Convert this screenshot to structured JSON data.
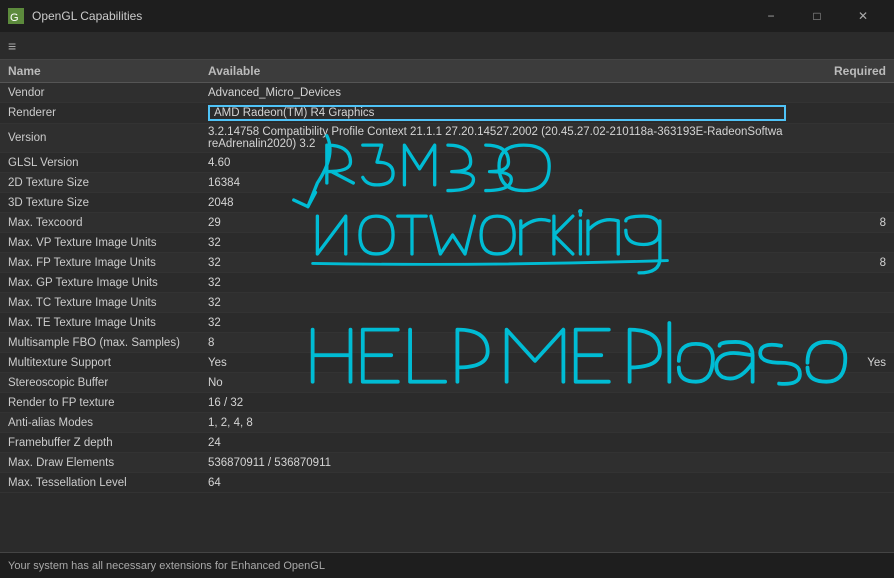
{
  "window": {
    "title": "OpenGL Capabilities",
    "icon": "⬜"
  },
  "toolbar": {
    "menu_icon": "≡"
  },
  "table": {
    "headers": {
      "name": "Name",
      "available": "Available",
      "required": "Required"
    },
    "rows": [
      {
        "name": "Vendor",
        "available": "Advanced_Micro_Devices",
        "required": "",
        "highlighted": false
      },
      {
        "name": "Renderer",
        "available": "AMD Radeon(TM) R4 Graphics",
        "required": "",
        "highlighted": true
      },
      {
        "name": "Version",
        "available": "3.2.14758 Compatibility Profile Context 21.1.1 27.20.14527.2002 (20.45.27.02-210118a-363193E-RadeonSoftwareAdrenalin2020)  3.2",
        "required": "",
        "highlighted": false
      },
      {
        "name": "GLSL Version",
        "available": "4.60",
        "required": "",
        "highlighted": false
      },
      {
        "name": "2D Texture Size",
        "available": "16384",
        "required": "",
        "highlighted": false
      },
      {
        "name": "3D Texture Size",
        "available": "2048",
        "required": "",
        "highlighted": false
      },
      {
        "name": "Max. Texcoord",
        "available": "29",
        "required": "8",
        "highlighted": false
      },
      {
        "name": "Max. VP Texture Image Units",
        "available": "32",
        "required": "",
        "highlighted": false
      },
      {
        "name": "Max. FP Texture Image Units",
        "available": "32",
        "required": "8",
        "highlighted": false
      },
      {
        "name": "Max. GP Texture Image Units",
        "available": "32",
        "required": "",
        "highlighted": false
      },
      {
        "name": "Max. TC Texture Image Units",
        "available": "32",
        "required": "",
        "highlighted": false
      },
      {
        "name": "Max. TE Texture Image Units",
        "available": "32",
        "required": "",
        "highlighted": false
      },
      {
        "name": "Multisample FBO (max. Samples)",
        "available": "8",
        "required": "",
        "highlighted": false
      },
      {
        "name": "Multitexture Support",
        "available": "Yes",
        "required": "Yes",
        "highlighted": false
      },
      {
        "name": "Stereoscopic Buffer",
        "available": "No",
        "required": "",
        "highlighted": false
      },
      {
        "name": "Render to FP texture",
        "available": "16 / 32",
        "required": "",
        "highlighted": false
      },
      {
        "name": "Anti-alias Modes",
        "available": "1, 2, 4, 8",
        "required": "",
        "highlighted": false
      },
      {
        "name": "Framebuffer Z depth",
        "available": "24",
        "required": "",
        "highlighted": false
      },
      {
        "name": "Max. Draw Elements",
        "available": "536870911 / 536870911",
        "required": "",
        "highlighted": false
      },
      {
        "name": "Max. Tessellation Level",
        "available": "64",
        "required": "",
        "highlighted": false
      }
    ]
  },
  "status_bar": {
    "text": "Your system has all necessary extensions for Enhanced OpenGL"
  },
  "title_bar_controls": {
    "minimize": "−",
    "maximize": "□",
    "close": "✕"
  }
}
